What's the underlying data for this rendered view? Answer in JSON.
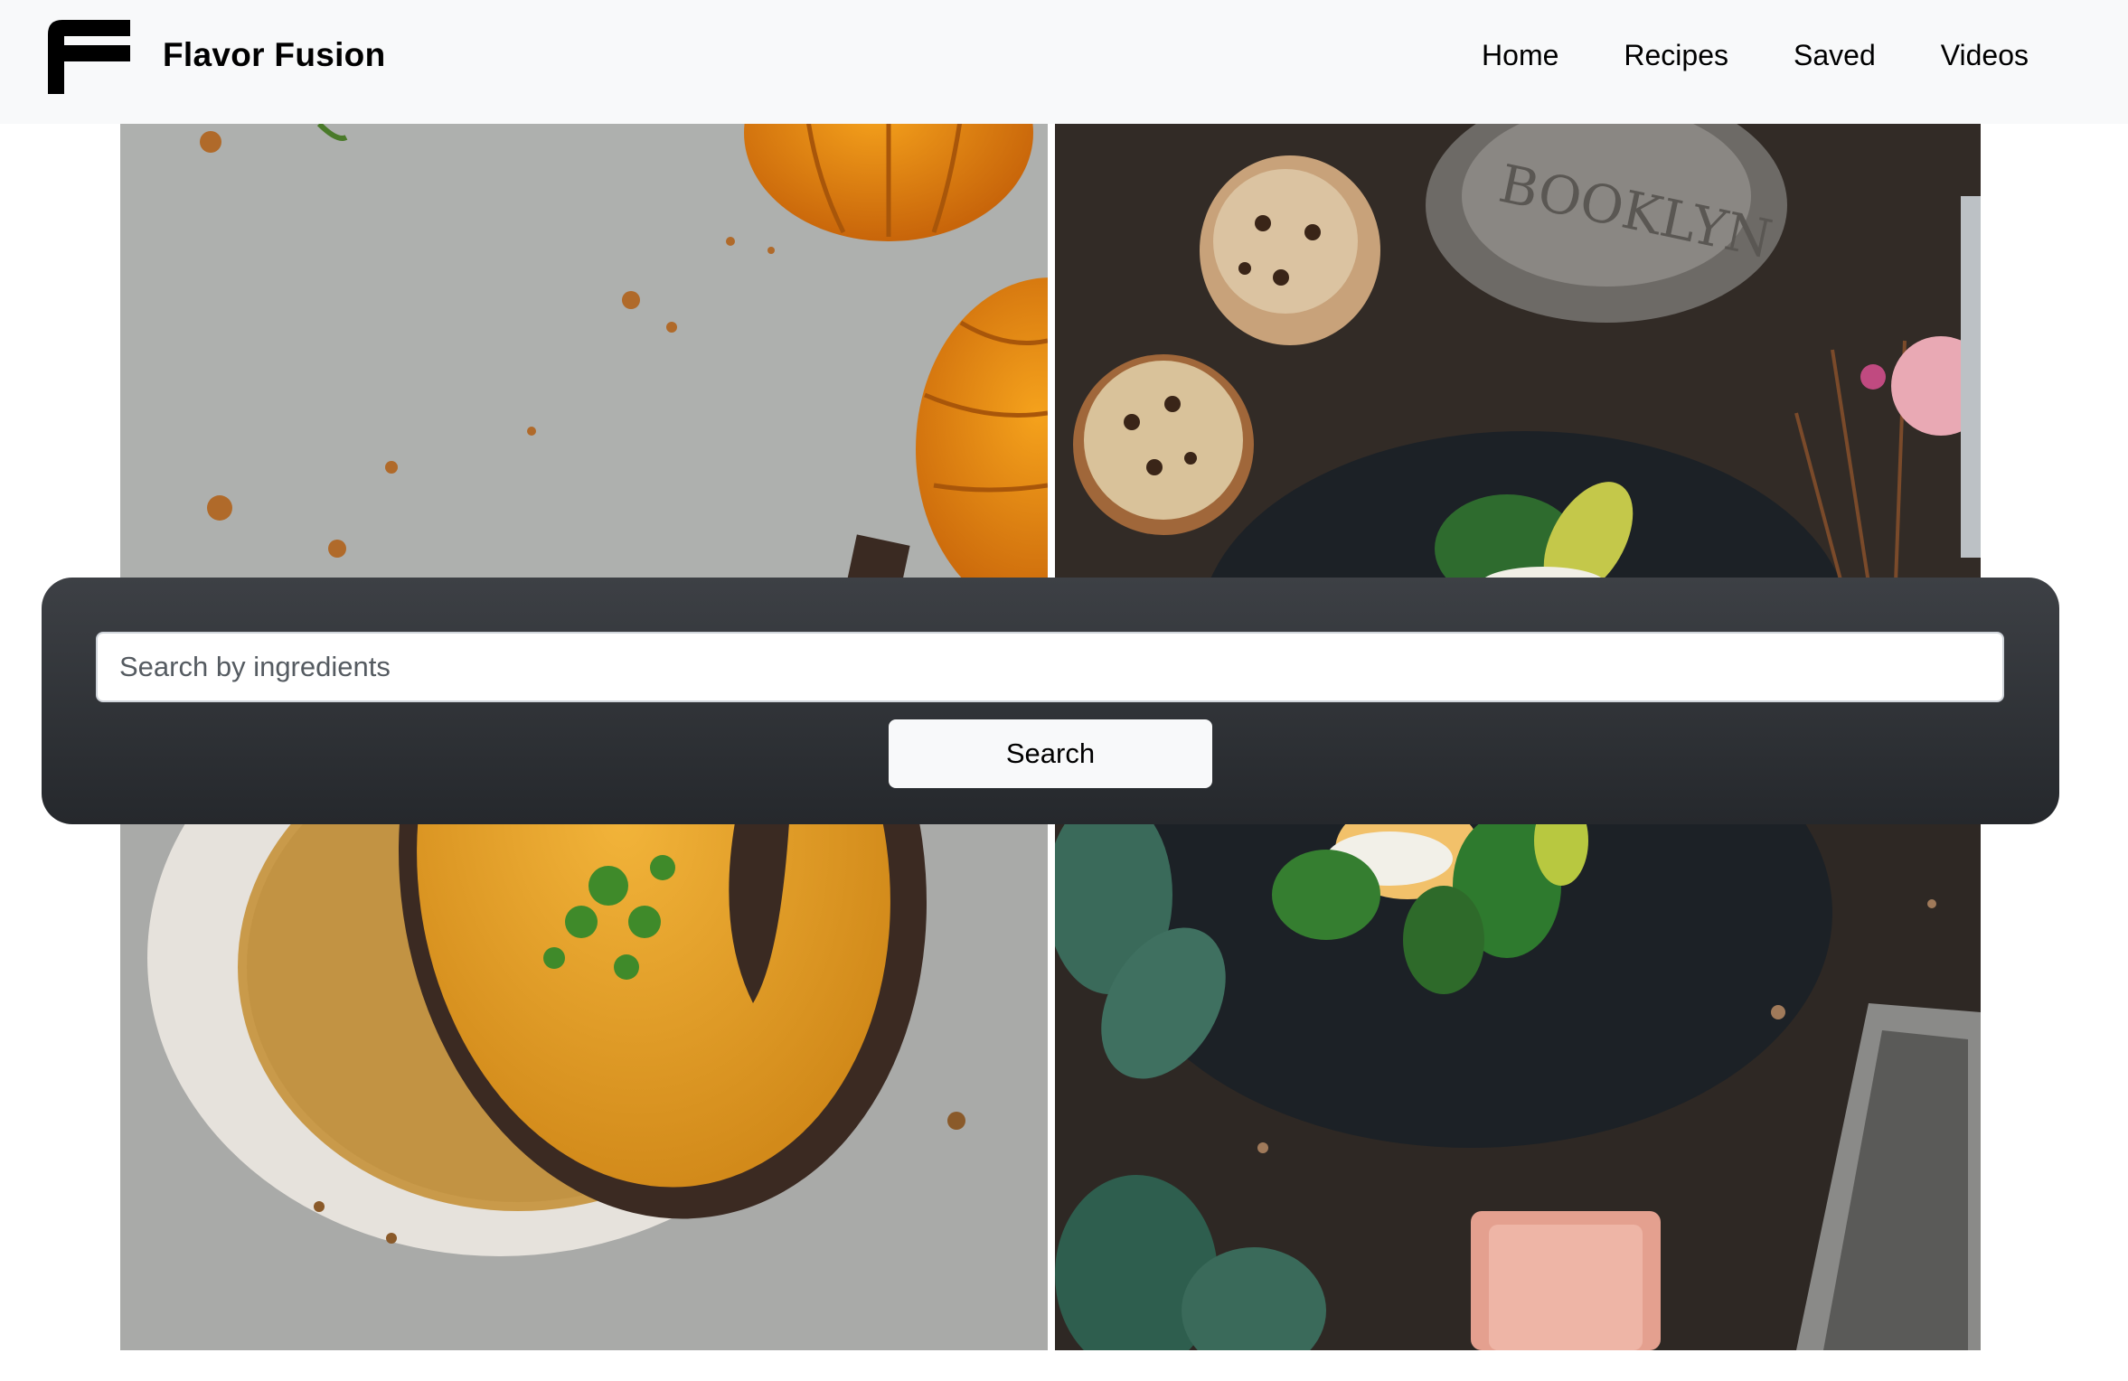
{
  "brand": {
    "name": "Flavor Fusion",
    "logo_icon": "letter-f-logo-icon"
  },
  "nav": {
    "items": [
      {
        "label": "Home"
      },
      {
        "label": "Recipes"
      },
      {
        "label": "Saved"
      },
      {
        "label": "Videos"
      }
    ]
  },
  "search": {
    "placeholder": "Search by ingredients",
    "value": "",
    "button_label": "Search"
  },
  "colors": {
    "navbar_bg": "#f8f9fa",
    "panel_gradient_top": "#3d4045",
    "panel_gradient_bottom": "#25282c",
    "button_bg": "#f8f9fa"
  }
}
